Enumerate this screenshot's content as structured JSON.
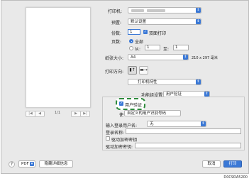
{
  "preview": {
    "page_count": "1/1",
    "first": "|◀",
    "prev": "◀",
    "next": "▶",
    "last": "▶|"
  },
  "printer": {
    "label": "打印机:"
  },
  "preset": {
    "label": "预置:",
    "value": "默认设置"
  },
  "copies": {
    "label": "份数:",
    "value": "1",
    "duplex_label": "双面打印"
  },
  "pages": {
    "label": "页数:",
    "all_label": "全部",
    "from_label": "从:",
    "from_value": "1",
    "to_label": "至:",
    "to_value": "1"
  },
  "paper": {
    "label": "纸张大小:",
    "value": "A4",
    "size_text": "210 x 297 毫米"
  },
  "orientation": {
    "label": "打印方向:"
  },
  "section": {
    "value": "打印机特性"
  },
  "feature_set": {
    "label": "功能组设置:",
    "value": "用户验证"
  },
  "auth": {
    "checkbox_label": "用户验证",
    "popup_prefix": "使",
    "popup_value": "自定义的用户识别号码",
    "input_name_label": "输入登录用户名:",
    "input_name_value": "无",
    "login_user_label": "登录名称:",
    "driver_key_checkbox_label": "驱动加密密钥",
    "driver_key_label": "驱动加密密钥:"
  },
  "footer": {
    "help": "?",
    "pdf": "PDF",
    "hide_details": "隐藏详细信息",
    "cancel": "取消",
    "print": "打印"
  },
  "caption": "D0C9DA5200",
  "colors": {
    "accent": "#3a78d6",
    "highlight": "#2e8b3d"
  }
}
